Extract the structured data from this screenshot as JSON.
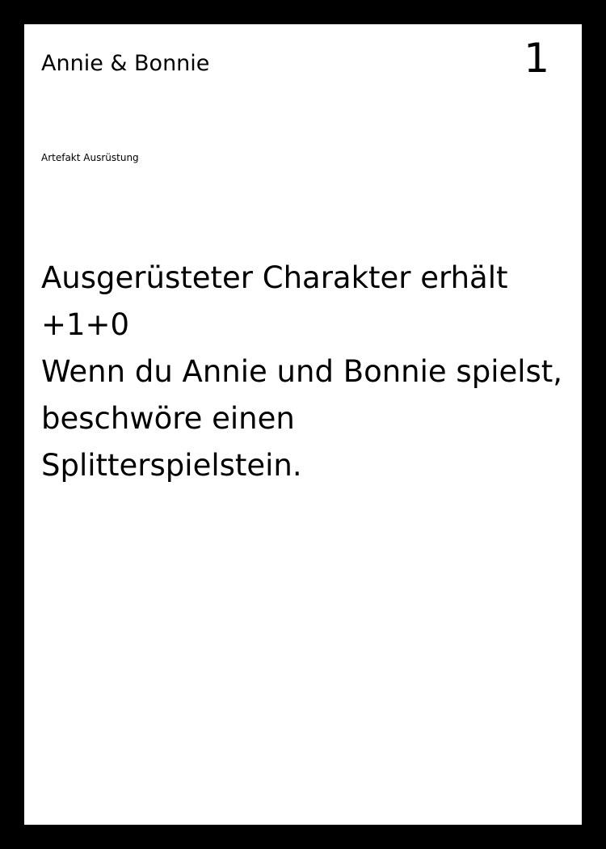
{
  "card": {
    "name": "Annie & Bonnie",
    "cost": "1",
    "type": "Artefakt Ausrüstung",
    "text_lines": [
      "Ausgerüsteter Charakter erhält",
      "+1+0",
      "Wenn du Annie und Bonnie spielst,",
      "beschwöre einen",
      "Splitterspielstein."
    ]
  },
  "colors": {
    "border": "#000000",
    "card_background": "#ffffff",
    "text": "#000000"
  }
}
